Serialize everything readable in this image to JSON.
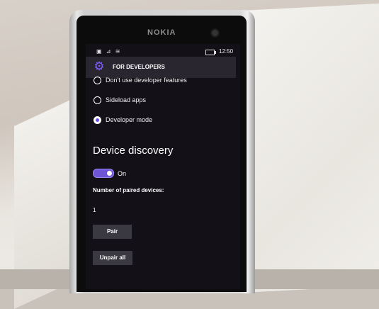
{
  "device": {
    "brand": "NOKIA"
  },
  "status_bar": {
    "time": "12:50",
    "icons": [
      "sim-icon",
      "signal-icon",
      "wifi-icon",
      "battery-icon"
    ]
  },
  "header": {
    "title": "FOR DEVELOPERS",
    "icon": "gear-icon",
    "accent": "#7f5cff"
  },
  "developer_options": [
    {
      "label": "Don't use developer features",
      "selected": false
    },
    {
      "label": "Sideload apps",
      "selected": false
    },
    {
      "label": "Developer mode",
      "selected": true
    }
  ],
  "device_discovery": {
    "title": "Device discovery",
    "toggle_state": "On",
    "paired_label": "Number of paired devices:",
    "paired_count": "1",
    "pair_button": "Pair",
    "unpair_button": "Unpair all"
  }
}
